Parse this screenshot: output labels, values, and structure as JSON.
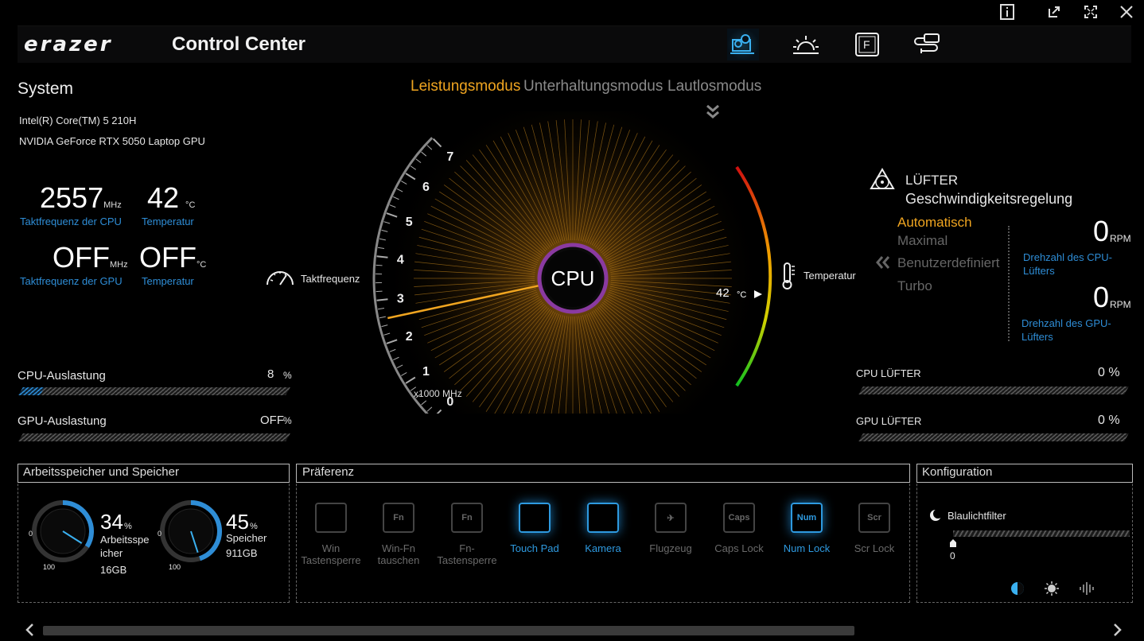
{
  "app": {
    "brand": "erazer",
    "title": "Control Center"
  },
  "colors": {
    "accent": "#f0a520",
    "link": "#2e8dd6",
    "active_blue": "#2e9ae0"
  },
  "nav_icons": [
    "gear-laptop-icon",
    "brightness-icon",
    "fn-key-icon",
    "cable-icon"
  ],
  "window_icons": [
    "info-icon",
    "restore-icon",
    "fullscreen-icon",
    "close-icon"
  ],
  "system": {
    "heading": "System",
    "cpu": "Intel(R) Core(TM) 5 210H",
    "gpu": "NVIDIA GeForce RTX 5050 Laptop GPU",
    "cpu_freq": {
      "value": "2557",
      "unit": "MHz",
      "label": "Taktfrequenz der CPU"
    },
    "cpu_temp": {
      "value": "42",
      "unit": "°C",
      "label": "Temperatur"
    },
    "gpu_freq": {
      "value": "OFF",
      "unit": "MHz",
      "label": "Taktfrequenz der GPU"
    },
    "gpu_temp": {
      "value": "OFF",
      "unit": "°C",
      "label": "Temperatur"
    }
  },
  "load": {
    "cpu": {
      "label": "CPU-Auslastung",
      "value": "8",
      "unit": "%",
      "fraction": 0.08
    },
    "gpu": {
      "label": "GPU-Auslastung",
      "value": "OFF",
      "unit": "%"
    }
  },
  "modes": {
    "performance": "Leistungsmodus",
    "entertainment": "Unterhaltungsmodus",
    "silent": "Lautlosmodus"
  },
  "gauge": {
    "center": "CPU",
    "left_label": "Taktfrequenz",
    "right_label": "Temperatur",
    "scale_ticks": [
      "0",
      "1",
      "2",
      "3",
      "4",
      "5",
      "6",
      "7"
    ],
    "scale_unit": "x1000 MHz",
    "temp_value": "42",
    "temp_unit": "°C",
    "freq_value_ghz": 2.557
  },
  "fan": {
    "title1": "LÜFTER",
    "title2": "Geschwindigkeitsregelung",
    "options": [
      "Automatisch",
      "Maximal",
      "Benutzerdefiniert",
      "Turbo"
    ],
    "selected": "Automatisch",
    "cpu_rpm": {
      "value": "0",
      "unit": "RPM",
      "label1": "Drehzahl des CPU-",
      "label2": "Lüfters"
    },
    "gpu_rpm": {
      "value": "0",
      "unit": "RPM",
      "label1": "Drehzahl des GPU-",
      "label2": "Lüfters"
    },
    "cpu_fan": {
      "label": "CPU LÜFTER",
      "value": "0 %"
    },
    "gpu_fan": {
      "label": "GPU LÜFTER",
      "value": "0 %"
    }
  },
  "memory": {
    "title": "Arbeitsspeicher und Speicher",
    "ram": {
      "percent": "34",
      "unit": "%",
      "label1": "Arbeitsspe",
      "label2": "icher",
      "size": "16GB",
      "min": "0",
      "max": "100"
    },
    "disk": {
      "percent": "45",
      "unit": "%",
      "label1": "Speicher",
      "size": "911GB",
      "min": "0",
      "max": "100"
    }
  },
  "preference": {
    "title": "Präferenz",
    "items": [
      {
        "icon": "win-lock-icon",
        "l1": "Win",
        "l2": "Tastensperre",
        "glyph": "",
        "active": false
      },
      {
        "icon": "win-fn-swap-icon",
        "l1": "Win-Fn",
        "l2": "tauschen",
        "glyph": "Fn",
        "active": false
      },
      {
        "icon": "fn-lock-icon",
        "l1": "Fn-",
        "l2": "Tastensperre",
        "glyph": "Fn",
        "active": false
      },
      {
        "icon": "touchpad-icon",
        "l1": "Touch Pad",
        "l2": "",
        "glyph": "",
        "active": true
      },
      {
        "icon": "camera-icon",
        "l1": "Kamera",
        "l2": "",
        "glyph": "",
        "active": true
      },
      {
        "icon": "airplane-icon",
        "l1": "Flugzeug",
        "l2": "",
        "glyph": "✈",
        "active": false
      },
      {
        "icon": "caps-lock-icon",
        "l1": "Caps Lock",
        "l2": "",
        "glyph": "Caps",
        "active": false
      },
      {
        "icon": "num-lock-icon",
        "l1": "Num Lock",
        "l2": "",
        "glyph": "Num",
        "active": true
      },
      {
        "icon": "scroll-lock-icon",
        "l1": "Scr Lock",
        "l2": "",
        "glyph": "Scr",
        "active": false
      }
    ]
  },
  "config": {
    "title": "Konfiguration",
    "bluelight_label": "Blaulichtfilter",
    "bluelight_value": "0"
  }
}
